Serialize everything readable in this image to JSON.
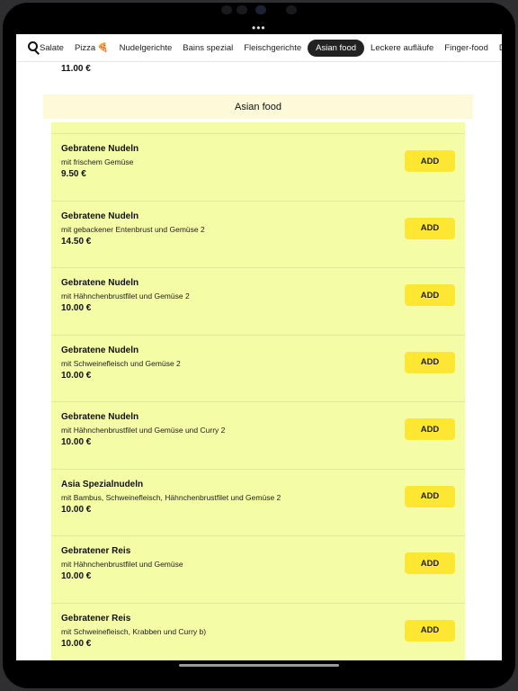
{
  "window": {
    "menu_dots": "•••"
  },
  "nav": {
    "categories": [
      {
        "label": "Salate"
      },
      {
        "label": "Pizza",
        "icon": "pizza-icon"
      },
      {
        "label": "Nudelgerichte"
      },
      {
        "label": "Bains spezial"
      },
      {
        "label": "Fleischgerichte"
      },
      {
        "label": "Asian food",
        "active": true
      },
      {
        "label": "Leckere aufläufe"
      },
      {
        "label": "Finger-food"
      },
      {
        "label": "D"
      }
    ]
  },
  "previous": {
    "price": "11.00 €"
  },
  "section": {
    "title": "Asian food"
  },
  "items": [
    {
      "name": "Gebratene Nudeln",
      "description": "mit frischem Gemüse",
      "price": "9.50 €",
      "button": "ADD"
    },
    {
      "name": "Gebratene Nudeln",
      "description": "mit gebackener Entenbrust und Gemüse 2",
      "price": "14.50 €",
      "button": "ADD"
    },
    {
      "name": "Gebratene Nudeln",
      "description": "mit Hähnchenbrustfilet und Gemüse 2",
      "price": "10.00 €",
      "button": "ADD"
    },
    {
      "name": "Gebratene Nudeln",
      "description": "mit Schweinefleisch und Gemüse 2",
      "price": "10.00 €",
      "button": "ADD"
    },
    {
      "name": "Gebratene Nudeln",
      "description": "mit Hähnchenbrustfilet und Gemüse und Curry 2",
      "price": "10.00 €",
      "button": "ADD"
    },
    {
      "name": "Asia Spezialnudeln",
      "description": "mit Bambus, Schweinefleisch, Hähnchenbrustfilet  und Gemüse 2",
      "price": "10.00 €",
      "button": "ADD"
    },
    {
      "name": "Gebratener Reis",
      "description": "mit Hähnchenbrustfilet und Gemüse",
      "price": "10.00 €",
      "button": "ADD"
    },
    {
      "name": "Gebratener Reis",
      "description": "mit Schweinefleisch, Krabben und Curry b)",
      "price": "10.00 €",
      "button": "ADD"
    }
  ],
  "colors": {
    "item_bg": "#f5fca6",
    "header_bg": "#fdf9d9",
    "add_button": "#fde732",
    "active_tab": "#222222"
  }
}
